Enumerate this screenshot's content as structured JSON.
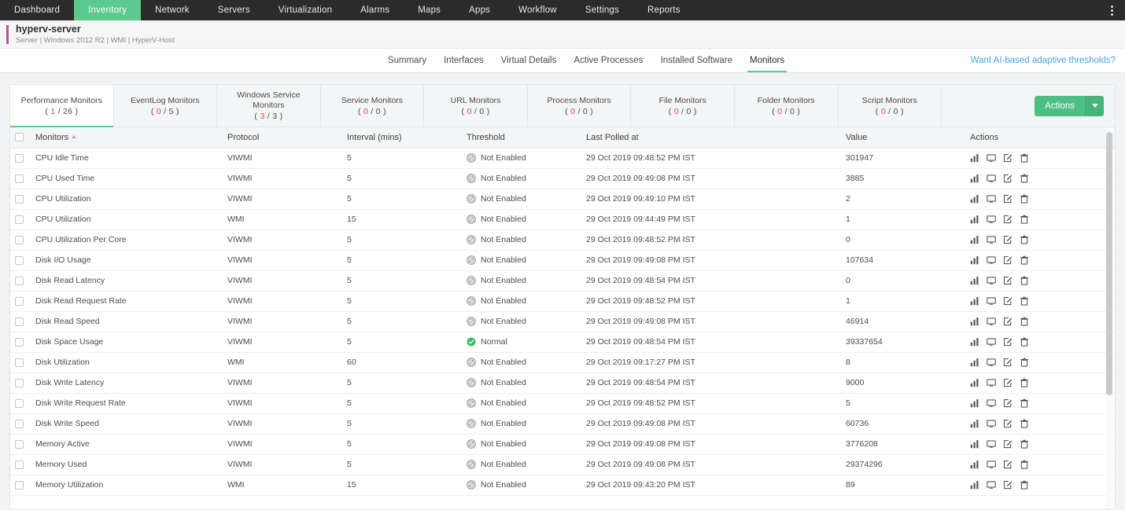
{
  "topnav": {
    "items": [
      {
        "label": "Dashboard",
        "active": false
      },
      {
        "label": "Inventory",
        "active": true
      },
      {
        "label": "Network",
        "active": false
      },
      {
        "label": "Servers",
        "active": false
      },
      {
        "label": "Virtualization",
        "active": false
      },
      {
        "label": "Alarms",
        "active": false
      },
      {
        "label": "Maps",
        "active": false
      },
      {
        "label": "Apps",
        "active": false
      },
      {
        "label": "Workflow",
        "active": false
      },
      {
        "label": "Settings",
        "active": false
      },
      {
        "label": "Reports",
        "active": false
      }
    ],
    "kebab_icon": "more-vertical-icon"
  },
  "server": {
    "name": "hyperv-server",
    "meta": "Server | Windows 2012 R2  | WMI  | HyperV-Host",
    "accent_color": "#b8519b"
  },
  "subnav": {
    "tabs": [
      {
        "label": "Summary",
        "active": false
      },
      {
        "label": "Interfaces",
        "active": false
      },
      {
        "label": "Virtual Details",
        "active": false
      },
      {
        "label": "Active Processes",
        "active": false
      },
      {
        "label": "Installed Software",
        "active": false
      },
      {
        "label": "Monitors",
        "active": true
      }
    ],
    "link": "Want AI-based adaptive thresholds?",
    "link_color": "#4aa3df"
  },
  "monitor_tabs": [
    {
      "label": "Performance Monitors",
      "selected": 1,
      "total": 26,
      "active": true
    },
    {
      "label": "EventLog Monitors",
      "selected": 0,
      "total": 5,
      "active": false
    },
    {
      "label": "Windows Service Monitors",
      "selected": 3,
      "total": 3,
      "active": false
    },
    {
      "label": "Service Monitors",
      "selected": 0,
      "total": 0,
      "active": false
    },
    {
      "label": "URL Monitors",
      "selected": 0,
      "total": 0,
      "active": false
    },
    {
      "label": "Process Monitors",
      "selected": 0,
      "total": 0,
      "active": false
    },
    {
      "label": "File Monitors",
      "selected": 0,
      "total": 0,
      "active": false
    },
    {
      "label": "Folder Monitors",
      "selected": 0,
      "total": 0,
      "active": false
    },
    {
      "label": "Script Monitors",
      "selected": 0,
      "total": 0,
      "active": false
    }
  ],
  "toolbar": {
    "actions_label": "Actions",
    "actions_caret_icon": "chevron-down-icon",
    "accent_color": "#4cbf85"
  },
  "table": {
    "columns": [
      "Monitors",
      "Protocol",
      "Interval (mins)",
      "Threshold",
      "Last Polled at",
      "Value",
      "Actions"
    ],
    "sort_column": "Monitors",
    "sort_direction": "asc",
    "row_action_icons": [
      "bar-chart-icon",
      "monitor-screen-icon",
      "edit-pencil-icon",
      "trash-icon"
    ],
    "threshold_states": {
      "not_enabled": {
        "label": "Not Enabled",
        "color": "#9b9b9b"
      },
      "normal": {
        "label": "Normal",
        "color": "#32bf5f"
      }
    },
    "rows": [
      {
        "name": "CPU Idle Time",
        "protocol": "VIWMI",
        "interval": "5",
        "threshold": "Not Enabled",
        "threshold_state": "not_enabled",
        "polled": "29 Oct 2019 09:48:52 PM IST",
        "value": "301947"
      },
      {
        "name": "CPU Used Time",
        "protocol": "VIWMI",
        "interval": "5",
        "threshold": "Not Enabled",
        "threshold_state": "not_enabled",
        "polled": "29 Oct 2019 09:49:08 PM IST",
        "value": "3885"
      },
      {
        "name": "CPU Utilization",
        "protocol": "VIWMI",
        "interval": "5",
        "threshold": "Not Enabled",
        "threshold_state": "not_enabled",
        "polled": "29 Oct 2019 09:49:10 PM IST",
        "value": "2"
      },
      {
        "name": "CPU Utilization",
        "protocol": "WMI",
        "interval": "15",
        "threshold": "Not Enabled",
        "threshold_state": "not_enabled",
        "polled": "29 Oct 2019 09:44:49 PM IST",
        "value": "1"
      },
      {
        "name": "CPU Utilization Per Core",
        "protocol": "VIWMI",
        "interval": "5",
        "threshold": "Not Enabled",
        "threshold_state": "not_enabled",
        "polled": "29 Oct 2019 09:48:52 PM IST",
        "value": "0"
      },
      {
        "name": "Disk I/O Usage",
        "protocol": "VIWMI",
        "interval": "5",
        "threshold": "Not Enabled",
        "threshold_state": "not_enabled",
        "polled": "29 Oct 2019 09:49:08 PM IST",
        "value": "107634"
      },
      {
        "name": "Disk Read Latency",
        "protocol": "VIWMI",
        "interval": "5",
        "threshold": "Not Enabled",
        "threshold_state": "not_enabled",
        "polled": "29 Oct 2019 09:48:54 PM IST",
        "value": "0"
      },
      {
        "name": "Disk Read Request Rate",
        "protocol": "VIWMI",
        "interval": "5",
        "threshold": "Not Enabled",
        "threshold_state": "not_enabled",
        "polled": "29 Oct 2019 09:48:52 PM IST",
        "value": "1"
      },
      {
        "name": "Disk Read Speed",
        "protocol": "VIWMI",
        "interval": "5",
        "threshold": "Not Enabled",
        "threshold_state": "not_enabled",
        "polled": "29 Oct 2019 09:49:08 PM IST",
        "value": "46914"
      },
      {
        "name": "Disk Space Usage",
        "protocol": "VIWMI",
        "interval": "5",
        "threshold": "Normal",
        "threshold_state": "normal",
        "polled": "29 Oct 2019 09:48:54 PM IST",
        "value": "39337654"
      },
      {
        "name": "Disk Utilization",
        "protocol": "WMI",
        "interval": "60",
        "threshold": "Not Enabled",
        "threshold_state": "not_enabled",
        "polled": "29 Oct 2019 09:17:27 PM IST",
        "value": "8"
      },
      {
        "name": "Disk Write Latency",
        "protocol": "VIWMI",
        "interval": "5",
        "threshold": "Not Enabled",
        "threshold_state": "not_enabled",
        "polled": "29 Oct 2019 09:48:54 PM IST",
        "value": "9000"
      },
      {
        "name": "Disk Write Request Rate",
        "protocol": "VIWMI",
        "interval": "5",
        "threshold": "Not Enabled",
        "threshold_state": "not_enabled",
        "polled": "29 Oct 2019 09:48:52 PM IST",
        "value": "5"
      },
      {
        "name": "Disk Write Speed",
        "protocol": "VIWMI",
        "interval": "5",
        "threshold": "Not Enabled",
        "threshold_state": "not_enabled",
        "polled": "29 Oct 2019 09:49:08 PM IST",
        "value": "60736"
      },
      {
        "name": "Memory Active",
        "protocol": "VIWMI",
        "interval": "5",
        "threshold": "Not Enabled",
        "threshold_state": "not_enabled",
        "polled": "29 Oct 2019 09:49:08 PM IST",
        "value": "3776208"
      },
      {
        "name": "Memory Used",
        "protocol": "VIWMI",
        "interval": "5",
        "threshold": "Not Enabled",
        "threshold_state": "not_enabled",
        "polled": "29 Oct 2019 09:49:08 PM IST",
        "value": "29374296"
      },
      {
        "name": "Memory Utilization",
        "protocol": "WMI",
        "interval": "15",
        "threshold": "Not Enabled",
        "threshold_state": "not_enabled",
        "polled": "29 Oct 2019 09:43:20 PM IST",
        "value": "89"
      }
    ]
  }
}
